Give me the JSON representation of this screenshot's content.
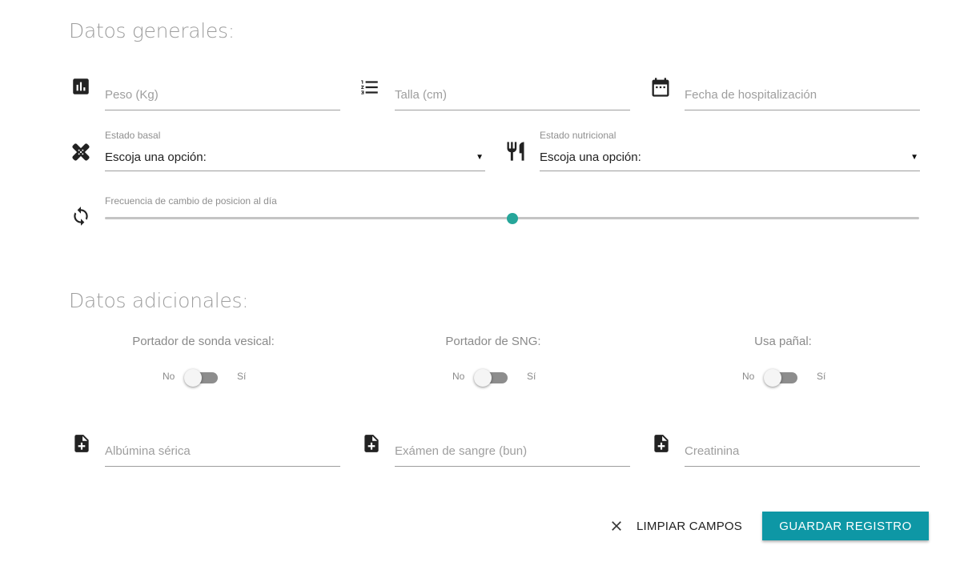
{
  "general": {
    "title": "Datos generales:",
    "peso": {
      "placeholder": "Peso (Kg)",
      "icon": "bar-chart-icon"
    },
    "talla": {
      "placeholder": "Talla (cm)",
      "icon": "numbered-list-icon"
    },
    "fecha": {
      "placeholder": "Fecha de hospitalización",
      "icon": "calendar-icon"
    },
    "estado_basal": {
      "label": "Estado basal",
      "value": "Escoja una opción:",
      "icon": "bandage-icon"
    },
    "estado_nutricional": {
      "label": "Estado nutricional",
      "value": "Escoja una opción:",
      "icon": "restaurant-icon"
    },
    "frecuencia": {
      "label": "Frecuencia de cambio de posicion al día",
      "value_fraction": 0.5,
      "icon": "sync-icon",
      "accent": "#26a69a"
    }
  },
  "additional": {
    "title": "Datos adicionales:",
    "toggles": [
      {
        "title": "Portador de sonda vesical:",
        "off": "No",
        "on": "Sí",
        "checked": false
      },
      {
        "title": "Portador de SNG:",
        "off": "No",
        "on": "Sí",
        "checked": false
      },
      {
        "title": "Usa pañal:",
        "off": "No",
        "on": "Sí",
        "checked": false
      }
    ],
    "albumina": {
      "placeholder": "Albúmina sérica",
      "icon": "note-add-icon"
    },
    "bun": {
      "placeholder": "Exámen de sangre (bun)",
      "icon": "note-add-icon"
    },
    "creatinina": {
      "placeholder": "Creatinina",
      "icon": "note-add-icon"
    }
  },
  "actions": {
    "clear": "LIMPIAR CAMPOS",
    "save": "GUARDAR REGISTRO",
    "save_color": "#0e97a5"
  }
}
